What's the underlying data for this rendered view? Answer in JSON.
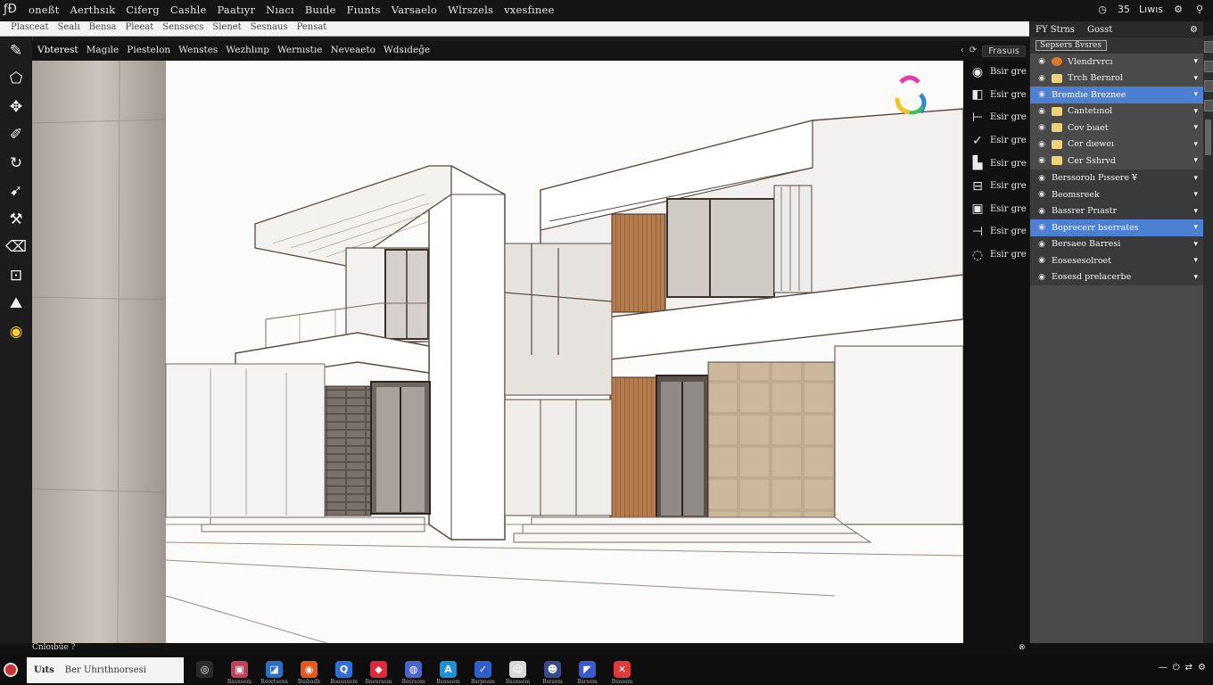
{
  "menubar": {
    "logo": "ƒÐ",
    "items": [
      "oneßt",
      "Aerthsık",
      "Ciferg",
      "Cashle",
      "Paatıyr",
      "Nıacı",
      "Buıde",
      "Fıunts",
      "Varsaelo",
      "Wlrszels",
      "vxesfınee"
    ],
    "status": {
      "time": "35",
      "user": "Lıwıs"
    }
  },
  "optstrip": {
    "items": [
      "Plasceat",
      "Sealı",
      "Bensa",
      "Pleeat",
      "Senssecs",
      "Slenet",
      "Sesnaus",
      "Pensat"
    ]
  },
  "tabbar": {
    "tabs": [
      "Vbterest",
      "Magıle",
      "Piestelon",
      "Wenstes",
      "Wezhlınp",
      "Wernıstıe",
      "Neveaeto",
      "Wdsıdeğe"
    ],
    "right_label": "Frasuıs"
  },
  "tools": [
    {
      "name": "pen-tool",
      "glyph": "✎"
    },
    {
      "name": "shape-tool",
      "glyph": "⬠"
    },
    {
      "name": "transform-tool",
      "glyph": "✥"
    },
    {
      "name": "brush-tool",
      "glyph": "✐"
    },
    {
      "name": "lasso-tool",
      "glyph": "↻"
    },
    {
      "name": "move-tool",
      "glyph": "➹"
    },
    {
      "name": "hammer-tool",
      "glyph": "⚒"
    },
    {
      "name": "eraser-tool",
      "glyph": "⌫"
    },
    {
      "name": "crop-tool",
      "glyph": "⊡"
    },
    {
      "name": "fill-tool",
      "glyph": "⛰"
    },
    {
      "name": "color-tool",
      "glyph": "◉"
    }
  ],
  "toolprops": [
    {
      "glyph": "◉",
      "label": "Bsir gre"
    },
    {
      "glyph": "◧",
      "label": "Esir gre"
    },
    {
      "glyph": "⊢",
      "label": "Esir gre"
    },
    {
      "glyph": "✓",
      "label": "Esir gre"
    },
    {
      "glyph": "▙",
      "label": "Esir gre"
    },
    {
      "glyph": "⊟",
      "label": "Esir gre"
    },
    {
      "glyph": "▣",
      "label": "Esir gre"
    },
    {
      "glyph": "⊣",
      "label": "Esir gre"
    },
    {
      "glyph": "◌",
      "label": "Esir gre"
    }
  ],
  "rpanel": {
    "header_left": [
      "FY Strns",
      "Gosst"
    ],
    "header_right": "⚙",
    "sub_label": "Sepsers ßvsres",
    "layers_top": [
      {
        "label": "Vlendrvrcı",
        "selected": false,
        "thumb": "c"
      },
      {
        "label": "Trch Bernrol",
        "selected": false,
        "thumb": "b"
      },
      {
        "label": "Bremdıe Breznee",
        "selected": true,
        "thumb": "none"
      },
      {
        "label": "Cantetınol",
        "selected": false,
        "thumb": "b"
      },
      {
        "label": "Cov bıaet",
        "selected": false,
        "thumb": "b"
      },
      {
        "label": "Cer dıeweı",
        "selected": false,
        "thumb": "b"
      },
      {
        "label": "Cer Sshrvd",
        "selected": false,
        "thumb": "b"
      }
    ],
    "layers_bottom": [
      {
        "label": "Berssorolı Pıssere ¥",
        "selected": false
      },
      {
        "label": "Beomsreek",
        "selected": false
      },
      {
        "label": "Bassrer Prıastr",
        "selected": false
      },
      {
        "label": "Boprecerr bserrates",
        "selected": true
      },
      {
        "label": "Bersaeo Barresi",
        "selected": false
      },
      {
        "label": "Eosesesolroet",
        "selected": false
      },
      {
        "label": "Eosesd prelacerbe",
        "selected": false
      }
    ]
  },
  "statusbar": {
    "left": "Cnloıbüe ?",
    "right": "⊗"
  },
  "taskbar": {
    "search_primary": "Uıts",
    "search_placeholder": "Ber Uhrıthnorsesi",
    "apps": [
      {
        "name": "chrome",
        "color": "#2a2a2a",
        "glyph": "◎",
        "label": ""
      },
      {
        "name": "photos",
        "color": "#c0405a",
        "glyph": "▣",
        "label": "Basnsem"
      },
      {
        "name": "ps",
        "color": "#2f6fc0",
        "glyph": "◪",
        "label": "Roortsens"
      },
      {
        "name": "record",
        "color": "#e55a1a",
        "glyph": "◉",
        "label": "Buıbadh"
      },
      {
        "name": "qapp",
        "color": "#2f6fd8",
        "glyph": "Q",
        "label": "Boasnsem"
      },
      {
        "name": "shield",
        "color": "#e02a3a",
        "glyph": "◆",
        "label": "Bnesrsem"
      },
      {
        "name": "globe",
        "color": "#4a64c8",
        "glyph": "◍",
        "label": "Besrsom"
      },
      {
        "name": "pen",
        "color": "#1e90d8",
        "glyph": "A",
        "label": "Bsnssem"
      },
      {
        "name": "check",
        "color": "#2f5fc8",
        "glyph": "✓",
        "label": "Bsrpeam"
      },
      {
        "name": "face",
        "color": "#d8d8d8",
        "glyph": "☺",
        "label": "Basnsem"
      },
      {
        "name": "user",
        "color": "#3a4a8a",
        "glyph": "☻",
        "label": "Bsrsem"
      },
      {
        "name": "vs",
        "color": "#3a5ad0",
        "glyph": "◤",
        "label": "Bsrsem"
      },
      {
        "name": "x",
        "color": "#e03a3a",
        "glyph": "✕",
        "label": "Bsnsem"
      }
    ],
    "tray": [
      "—",
      "⏻",
      "⇄",
      "⚙"
    ]
  },
  "canvas": {
    "colors": {
      "wood": "#b7804f",
      "stone": "#c7b094",
      "darkstone": "#5a5048",
      "line": "#5a4a40",
      "glass": "#8a8580"
    }
  }
}
